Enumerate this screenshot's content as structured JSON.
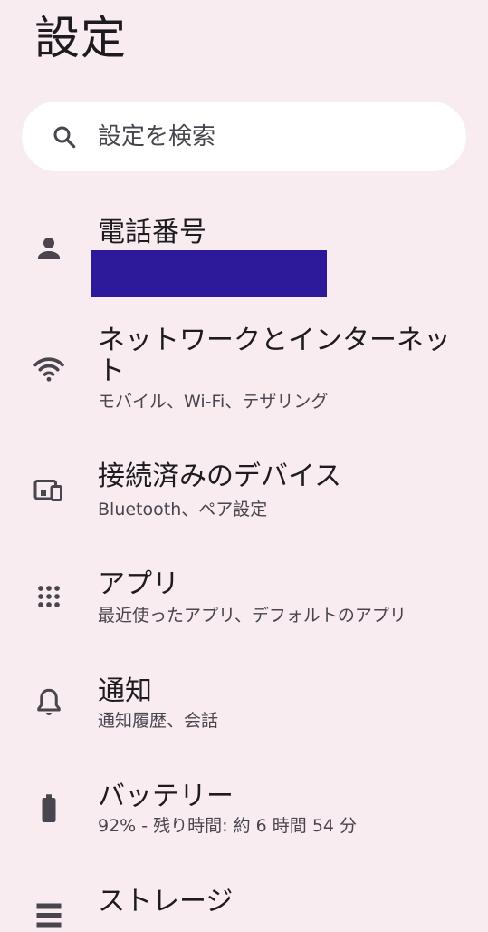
{
  "header": {
    "title": "設定"
  },
  "search": {
    "placeholder": "設定を検索"
  },
  "items": [
    {
      "title": "電話番号",
      "subtitle": "",
      "icon": "person-icon"
    },
    {
      "title": "ネットワークとインターネット",
      "subtitle": "モバイル、Wi-Fi、テザリング",
      "icon": "wifi-icon"
    },
    {
      "title": "接続済みのデバイス",
      "subtitle": "Bluetooth、ペア設定",
      "icon": "devices-icon"
    },
    {
      "title": "アプリ",
      "subtitle": "最近使ったアプリ、デフォルトのアプリ",
      "icon": "apps-grid-icon"
    },
    {
      "title": "通知",
      "subtitle": "通知履歴、会話",
      "icon": "bell-icon"
    },
    {
      "title": "バッテリー",
      "subtitle": "92% - 残り時間: 約 6 時間 54 分",
      "icon": "battery-icon"
    },
    {
      "title": "ストレージ",
      "subtitle": "",
      "icon": "storage-icon"
    }
  ],
  "colors": {
    "background": "#f8ecf0",
    "search_bg": "#ffffff",
    "icon": "#48454e",
    "redaction": "#2d1a9a"
  }
}
